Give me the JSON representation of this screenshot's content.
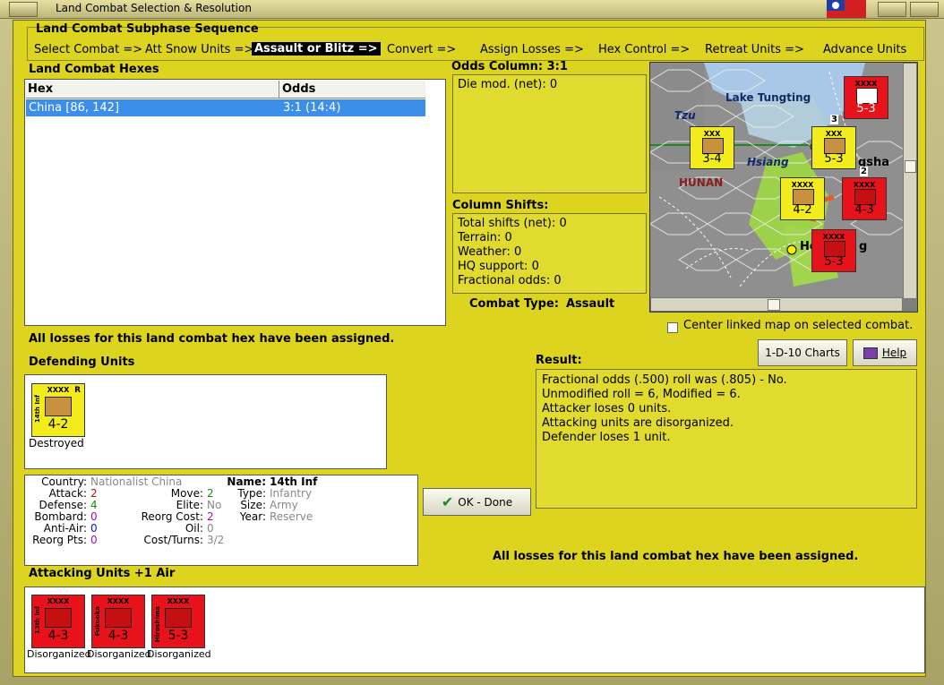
{
  "window": {
    "title": "Land Combat Selection & Resolution"
  },
  "sequence": {
    "title": "Land Combat Subphase Sequence",
    "steps": [
      "Select Combat =>",
      "Att Snow Units =>",
      "Assault or Blitz =>",
      "Convert =>",
      "Assign Losses =>",
      "Hex Control =>",
      "Retreat Units =>",
      "Advance Units"
    ],
    "active_index": 2
  },
  "hexes": {
    "title": "Land Combat Hexes",
    "columns": [
      "Hex",
      "Odds"
    ],
    "rows": [
      {
        "hex": "China [86, 142]",
        "odds": "3:1 (14:4)"
      }
    ]
  },
  "odds": {
    "title": "Odds Column: 3:1",
    "die_mod": "Die mod. (net): 0"
  },
  "shifts": {
    "title": "Column Shifts:",
    "items": [
      "Total shifts (net): 0",
      "Terrain: 0",
      "Weather: 0",
      "HQ support: 0",
      "Fractional odds: 0"
    ]
  },
  "combat_type": {
    "label": "Combat Type:",
    "value": "Assault"
  },
  "map": {
    "labels": [
      "Lake Tungting",
      "Tzu",
      "Hsiang",
      "HUNAN",
      "gsha",
      "He",
      "g"
    ],
    "units": [
      {
        "side": "20th Inf",
        "size": "XXXX",
        "val": "5-3"
      },
      {
        "side": "3rd Cav",
        "size": "XXX",
        "val": "3-4"
      },
      {
        "side": "3rd Inf",
        "size": "XXX",
        "val": "5-3"
      },
      {
        "side": "14th Inf",
        "size": "XXXX",
        "val": "4-2"
      },
      {
        "side": "",
        "size": "XXXX",
        "val": "4-3"
      },
      {
        "side": "Hiroshima",
        "size": "XXXX",
        "val": "5-3"
      }
    ],
    "stack_badges": [
      "3",
      "2"
    ],
    "center_label": "Center linked map on selected combat."
  },
  "buttons": {
    "charts": "1-D-10 Charts",
    "help": "Help",
    "ok": "OK - Done"
  },
  "losses_msg": "All losses for this land combat hex have been assigned.",
  "defending": {
    "title": "Defending Units",
    "unit": {
      "side": "14th Inf",
      "size": "XXXX",
      "val": "4-2",
      "reserve": "R",
      "status": "Destroyed"
    }
  },
  "result": {
    "title": "Result:",
    "lines": [
      "Fractional odds (.500) roll was (.805)  - No.",
      "Unmodified roll = 6, Modified = 6.",
      "Attacker loses 0 units.",
      "Attacking units are disorganized.",
      "Defender loses 1 unit."
    ]
  },
  "details": {
    "country_label": "Country:",
    "country": "Nationalist China",
    "attack_label": "Attack:",
    "attack": "2",
    "defense_label": "Defense:",
    "defense": "4",
    "bombard_label": "Bombard:",
    "bombard": "0",
    "antiair_label": "Anti-Air:",
    "antiair": "0",
    "reorgpts_label": "Reorg Pts:",
    "reorgpts": "0",
    "move_label": "Move:",
    "move": "2",
    "elite_label": "Elite:",
    "elite": "No",
    "reorgcost_label": "Reorg Cost:",
    "reorgcost": "2",
    "oil_label": "Oil:",
    "oil": "0",
    "costturns_label": "Cost/Turns:",
    "costturns": "3/2",
    "name_label": "Name:",
    "name": "14th Inf",
    "type_label": "Type:",
    "type": "Infantry",
    "size_label": "Size:",
    "size": "Army",
    "year_label": "Year:",
    "year": "Reserve"
  },
  "attacking": {
    "title": "Attacking Units +1 Air",
    "units": [
      {
        "side": "13th Inf",
        "size": "XXXX",
        "val": "4-3",
        "status": "Disorganized"
      },
      {
        "side": "Fukuoka",
        "size": "XXXX",
        "val": "4-3",
        "status": "Disorganized"
      },
      {
        "side": "Hiroshima",
        "size": "XXXX",
        "val": "5-3",
        "status": "Disorganized"
      }
    ]
  },
  "colors": {
    "panel": "#ddd420",
    "allied": "#f2ec1c",
    "axis": "#e8121a",
    "highlight": "#3b8fe8"
  }
}
